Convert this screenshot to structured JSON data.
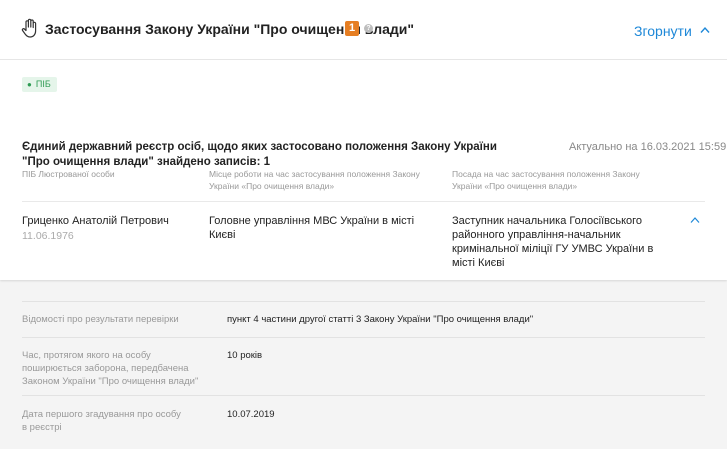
{
  "header": {
    "title": "Застосування Закону України \"Про очищення влади\"",
    "count": "1",
    "help": "?",
    "collapse_label": "Згорнути"
  },
  "tag": {
    "icon": "person-icon",
    "label": "ПІБ"
  },
  "registry": {
    "title": "Єдиний державний реєстр осіб, щодо яких застосовано положення Закону України \"Про очищення влади\" знайдено записів: 1",
    "actual": "Актуально на 16.03.2021 15:59"
  },
  "columns": {
    "name": "ПІБ Люстрованої особи",
    "workplace": "Місце роботи на час застосування положення Закону України «Про очищення влади»",
    "position": "Посада на час застосування положення Закону України «Про очищення влади»"
  },
  "row": {
    "name": "Гриценко Анатолій Петрович",
    "date": "11.06.1976",
    "workplace": "Головне управління МВС України в місті Києві",
    "position": "Заступник начальника Голосіївського районного управління-начальник кримінальної міліції ГУ УМВС України в місті Києві"
  },
  "details": [
    {
      "label": "Відомості про результати перевірки",
      "value": "пункт 4 частини другої статті 3 Закону України \"Про очищення влади\""
    },
    {
      "label": "Час, протягом якого на особу поширюється заборона, передбачена Законом України \"Про очищення влади\"",
      "value": "10 років"
    },
    {
      "label": "Дата першого згадування про особу в реєстрі",
      "value": "10.07.2019"
    }
  ],
  "colors": {
    "accent": "#1e88d8",
    "badge": "#e67e22",
    "tag_bg": "#e5f5ea",
    "tag_fg": "#2e9b53"
  }
}
